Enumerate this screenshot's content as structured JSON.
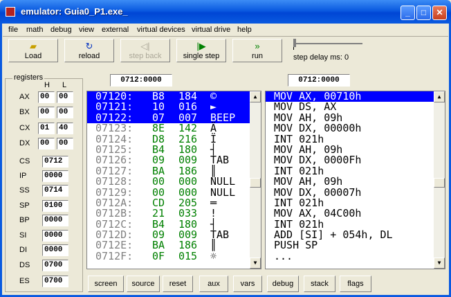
{
  "window": {
    "title": "emulator: Guia0_P1.exe_"
  },
  "menu": [
    "file",
    "math",
    "debug",
    "view",
    "external",
    "virtual devices",
    "virtual drive",
    "help"
  ],
  "toolbar": {
    "load": "Load",
    "reload": "reload",
    "step_back": "step back",
    "single_step": "single step",
    "run": "run",
    "delay_label": "step delay ms: 0"
  },
  "registers": {
    "title": "registers",
    "h_label": "H",
    "l_label": "L",
    "pairs": [
      {
        "name": "AX",
        "h": "00",
        "l": "00"
      },
      {
        "name": "BX",
        "h": "00",
        "l": "00"
      },
      {
        "name": "CX",
        "h": "01",
        "l": "40"
      },
      {
        "name": "DX",
        "h": "00",
        "l": "00"
      }
    ],
    "singles": [
      {
        "name": "CS",
        "value": "0712"
      },
      {
        "name": "IP",
        "value": "0000"
      },
      {
        "name": "SS",
        "value": "0714"
      },
      {
        "name": "SP",
        "value": "0100"
      },
      {
        "name": "BP",
        "value": "0000"
      },
      {
        "name": "SI",
        "value": "0000"
      },
      {
        "name": "DI",
        "value": "0000"
      },
      {
        "name": "DS",
        "value": "0700"
      },
      {
        "name": "ES",
        "value": "0700"
      }
    ]
  },
  "memory": {
    "address": "0712:0000",
    "rows": [
      {
        "addr": "07120:",
        "hex": "B8",
        "dec": "184",
        "chr": "©",
        "sel": true
      },
      {
        "addr": "07121:",
        "hex": "10",
        "dec": "016",
        "chr": "►",
        "sel": true
      },
      {
        "addr": "07122:",
        "hex": "07",
        "dec": "007",
        "chr": "BEEP",
        "sel": true
      },
      {
        "addr": "07123:",
        "hex": "8E",
        "dec": "142",
        "chr": "Ä",
        "sel": false
      },
      {
        "addr": "07124:",
        "hex": "D8",
        "dec": "216",
        "chr": "Ï",
        "sel": false
      },
      {
        "addr": "07125:",
        "hex": "B4",
        "dec": "180",
        "chr": "┤",
        "sel": false
      },
      {
        "addr": "07126:",
        "hex": "09",
        "dec": "009",
        "chr": "TAB",
        "sel": false
      },
      {
        "addr": "07127:",
        "hex": "BA",
        "dec": "186",
        "chr": "║",
        "sel": false
      },
      {
        "addr": "07128:",
        "hex": "00",
        "dec": "000",
        "chr": "NULL",
        "sel": false
      },
      {
        "addr": "07129:",
        "hex": "00",
        "dec": "000",
        "chr": "NULL",
        "sel": false
      },
      {
        "addr": "0712A:",
        "hex": "CD",
        "dec": "205",
        "chr": "═",
        "sel": false
      },
      {
        "addr": "0712B:",
        "hex": "21",
        "dec": "033",
        "chr": "!",
        "sel": false
      },
      {
        "addr": "0712C:",
        "hex": "B4",
        "dec": "180",
        "chr": "┤",
        "sel": false
      },
      {
        "addr": "0712D:",
        "hex": "09",
        "dec": "009",
        "chr": "TAB",
        "sel": false
      },
      {
        "addr": "0712E:",
        "hex": "BA",
        "dec": "186",
        "chr": "║",
        "sel": false
      },
      {
        "addr": "0712F:",
        "hex": "0F",
        "dec": "015",
        "chr": "☼",
        "sel": false
      }
    ]
  },
  "disasm": {
    "address": "0712:0000",
    "rows": [
      {
        "text": "MOV AX, 00710h",
        "sel": true
      },
      {
        "text": "MOV DS, AX",
        "sel": false
      },
      {
        "text": "MOV AH, 09h",
        "sel": false
      },
      {
        "text": "MOV DX, 00000h",
        "sel": false
      },
      {
        "text": "INT 021h",
        "sel": false
      },
      {
        "text": "MOV AH, 09h",
        "sel": false
      },
      {
        "text": "MOV DX, 0000Fh",
        "sel": false
      },
      {
        "text": "INT 021h",
        "sel": false
      },
      {
        "text": "MOV AH, 09h",
        "sel": false
      },
      {
        "text": "MOV DX, 00007h",
        "sel": false
      },
      {
        "text": "INT 021h",
        "sel": false
      },
      {
        "text": "MOV AX, 04C00h",
        "sel": false
      },
      {
        "text": "INT 021h",
        "sel": false
      },
      {
        "text": "ADD [SI] + 054h, DL",
        "sel": false
      },
      {
        "text": "PUSH SP",
        "sel": false
      },
      {
        "text": "...",
        "sel": false
      }
    ]
  },
  "bottom_buttons": [
    "screen",
    "source",
    "reset",
    "aux",
    "vars",
    "debug",
    "stack",
    "flags"
  ],
  "colors": {
    "selection": "#0000ff",
    "hex_green": "#008000",
    "addr_gray": "#808080",
    "titlebar": "#0a5ae0"
  }
}
